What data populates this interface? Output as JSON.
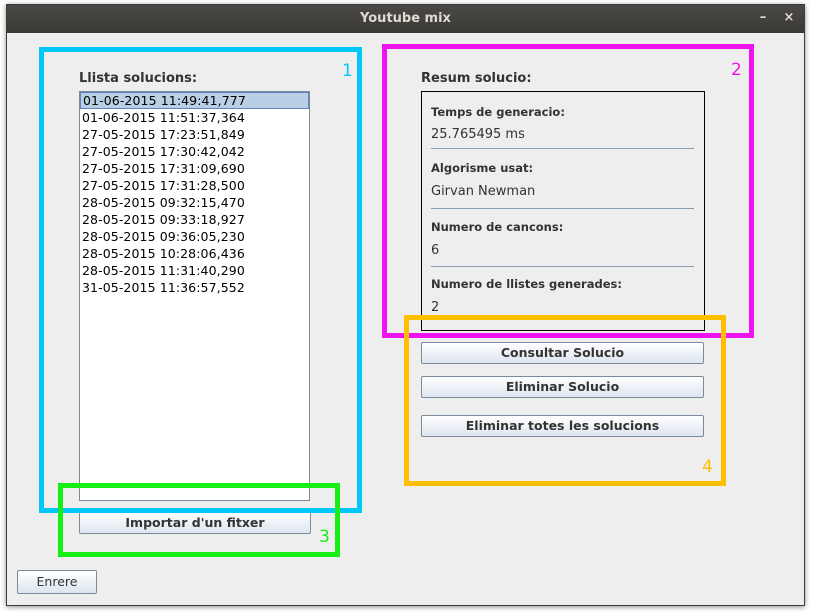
{
  "window": {
    "title": "Youtube mix",
    "minimize_glyph": "–",
    "close_glyph": "×"
  },
  "left": {
    "list_label": "Llista solucions:",
    "items": [
      "01-06-2015 11:49:41,777",
      "01-06-2015 11:51:37,364",
      "27-05-2015 17:23:51,849",
      "27-05-2015 17:30:42,042",
      "27-05-2015 17:31:09,690",
      "27-05-2015 17:31:28,500",
      "28-05-2015 09:32:15,470",
      "28-05-2015 09:33:18,927",
      "28-05-2015 09:36:05,230",
      "28-05-2015 10:28:06,436",
      "28-05-2015 11:31:40,290",
      "31-05-2015 11:36:57,552"
    ],
    "selected_index": 0,
    "import_button": "Importar d'un fitxer"
  },
  "summary": {
    "label": "Resum solucio:",
    "fields": [
      {
        "label": "Temps de generacio:",
        "value": "25.765495 ms"
      },
      {
        "label": "Algorisme usat:",
        "value": "Girvan Newman"
      },
      {
        "label": "Numero de cancons:",
        "value": "6"
      },
      {
        "label": "Numero de llistes generades:",
        "value": "2"
      }
    ]
  },
  "actions": {
    "consult": "Consultar Solucio",
    "delete": "Eliminar Solucio",
    "delete_all": "Eliminar totes les solucions"
  },
  "back_button": "Enrere",
  "annotations": [
    {
      "number": "1",
      "color": "#00c8f8"
    },
    {
      "number": "2",
      "color": "#ef14ef"
    },
    {
      "number": "3",
      "color": "#16ee16"
    },
    {
      "number": "4",
      "color": "#ffbf00"
    }
  ]
}
